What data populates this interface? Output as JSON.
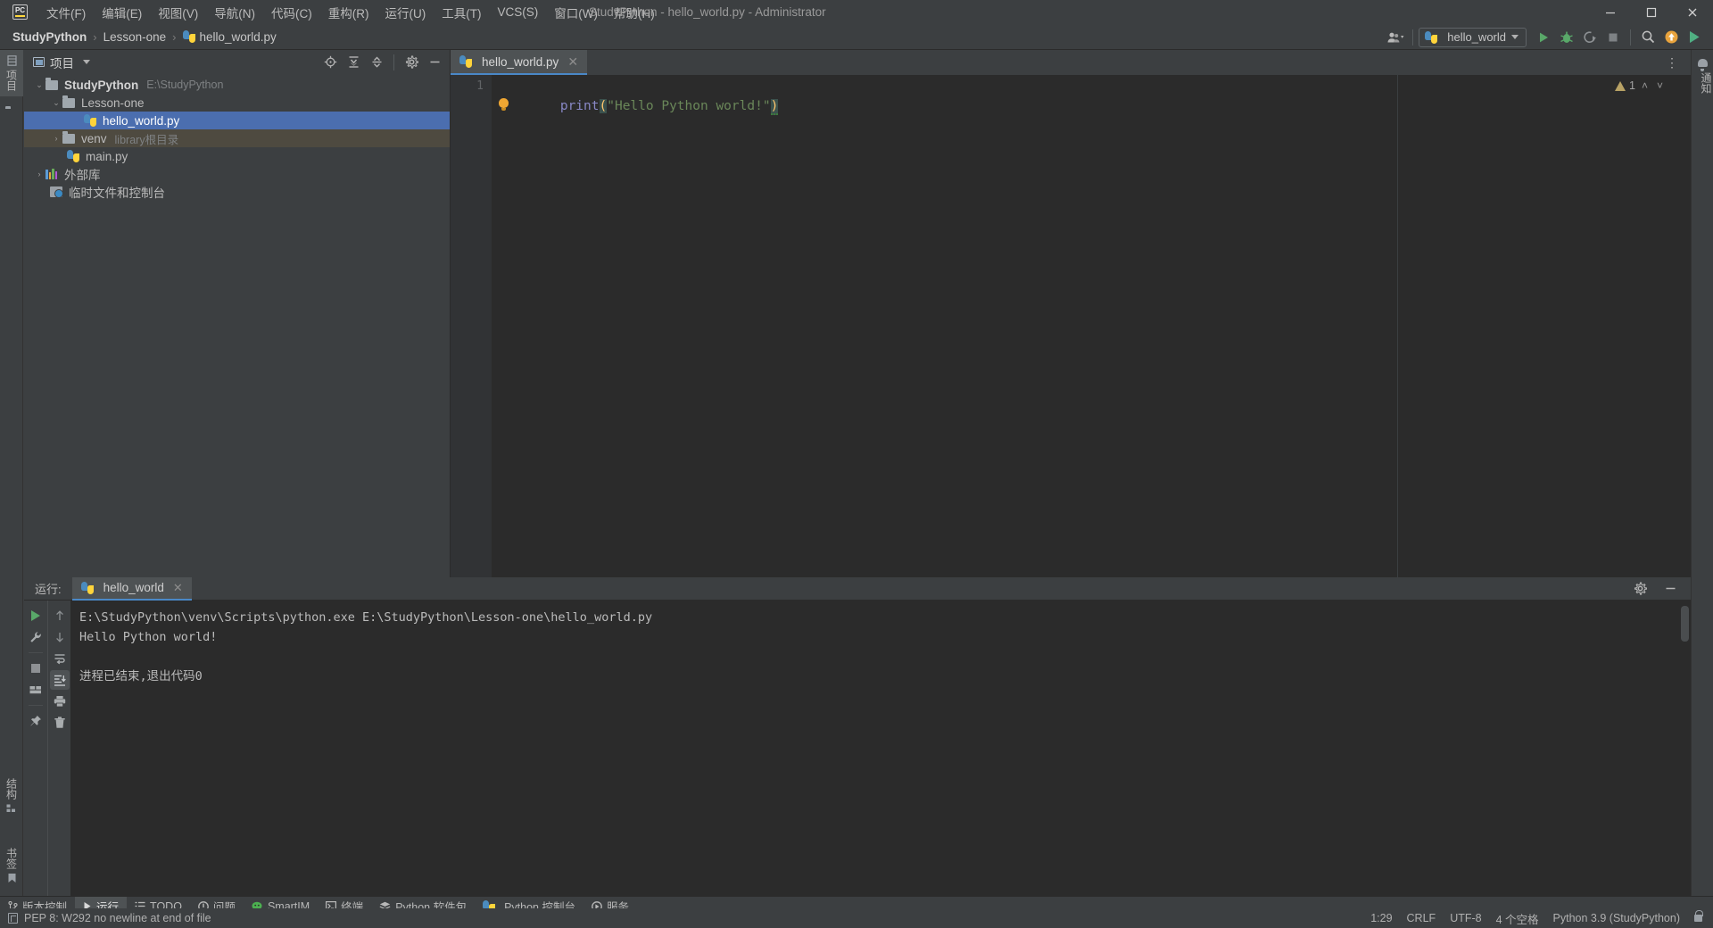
{
  "window": {
    "title": "StudyPython - hello_world.py - Administrator",
    "logo_text": "PC",
    "minimize": "—",
    "maximize": "☐",
    "close": "✕"
  },
  "menu": [
    {
      "label": "文件(F)",
      "name": "menu-file"
    },
    {
      "label": "编辑(E)",
      "name": "menu-edit"
    },
    {
      "label": "视图(V)",
      "name": "menu-view"
    },
    {
      "label": "导航(N)",
      "name": "menu-navigate"
    },
    {
      "label": "代码(C)",
      "name": "menu-code"
    },
    {
      "label": "重构(R)",
      "name": "menu-refactor"
    },
    {
      "label": "运行(U)",
      "name": "menu-run"
    },
    {
      "label": "工具(T)",
      "name": "menu-tools"
    },
    {
      "label": "VCS(S)",
      "name": "menu-vcs"
    },
    {
      "label": "窗口(W)",
      "name": "menu-window"
    },
    {
      "label": "帮助(H)",
      "name": "menu-help"
    }
  ],
  "breadcrumb": {
    "project": "StudyPython",
    "folder": "Lesson-one",
    "file": "hello_world.py",
    "separator": "›"
  },
  "toolbar": {
    "run_config": "hello_world",
    "run_tooltip": "运行",
    "debug_tooltip": "调试",
    "coverage_tooltip": "运行覆盖率",
    "stop_tooltip": "停止",
    "search_tooltip": "搜索",
    "update_tooltip": "更新",
    "profile_tooltip": "分析"
  },
  "left_strip": {
    "project_tab": "项目",
    "bottom_tabs": [
      "结构",
      "书签"
    ]
  },
  "right_strip": {
    "notifications": "通知"
  },
  "project_panel": {
    "title": "项目",
    "icons": [
      "locate-icon",
      "expand-all-icon",
      "collapse-all-icon",
      "settings-icon",
      "hide-icon"
    ],
    "tree": [
      {
        "label": "StudyPython",
        "sub": "E:\\StudyPython",
        "depth": 0,
        "kind": "folder",
        "twist": "⌄",
        "bold": true,
        "state": ""
      },
      {
        "label": "Lesson-one",
        "sub": "",
        "depth": 1,
        "kind": "folder",
        "twist": "⌄",
        "bold": false,
        "state": ""
      },
      {
        "label": "hello_world.py",
        "sub": "",
        "depth": 2,
        "kind": "python",
        "twist": "",
        "bold": false,
        "state": "selected"
      },
      {
        "label": "venv",
        "sub": "library根目录",
        "depth": 1,
        "kind": "folder",
        "twist": "›",
        "bold": false,
        "state": "hl"
      },
      {
        "label": "main.py",
        "sub": "",
        "depth": 2,
        "kind": "python",
        "twist": "",
        "bold": false,
        "state": ""
      },
      {
        "label": "外部库",
        "sub": "",
        "depth": 0,
        "kind": "library",
        "twist": "›",
        "bold": false,
        "state": ""
      },
      {
        "label": "临时文件和控制台",
        "sub": "",
        "depth": 0,
        "kind": "scratch",
        "twist": "",
        "bold": false,
        "state": ""
      }
    ]
  },
  "editor": {
    "tab_label": "hello_world.py",
    "tab_close": "✕",
    "kebab": "⋮",
    "line_numbers": [
      "1"
    ],
    "code": {
      "fn": "print",
      "open_paren": "(",
      "string": "\"Hello Python world!\"",
      "close_paren": ")"
    },
    "inspection": {
      "warning_count": "1",
      "up": "˄",
      "down": "˅"
    }
  },
  "run_panel": {
    "label": "运行:",
    "tab_label": "hello_world",
    "tab_close": "✕",
    "settings_icon": "gear-icon",
    "hide_icon": "hide-icon",
    "tools_left": [
      "rerun-icon",
      "settings-wrench-icon",
      "stop-icon",
      "layout-icon",
      "pin-icon"
    ],
    "tools_right": [
      "up-arrow-icon",
      "down-arrow-icon",
      "soft-wrap-icon",
      "scroll-to-end-icon",
      "print-icon",
      "clear-icon"
    ],
    "console": [
      "E:\\StudyPython\\venv\\Scripts\\python.exe E:\\StudyPython\\Lesson-one\\hello_world.py",
      "Hello Python world!",
      "",
      "进程已结束,退出代码0"
    ]
  },
  "bottom_tabs": [
    {
      "label": "版本控制",
      "icon": "branch-icon",
      "active": false
    },
    {
      "label": "运行",
      "icon": "play-icon",
      "active": true
    },
    {
      "label": "TODO",
      "icon": "todo-icon",
      "active": false
    },
    {
      "label": "问题",
      "icon": "problems-icon",
      "active": false
    },
    {
      "label": "SmartIM",
      "icon": "smartim-icon",
      "active": false
    },
    {
      "label": "终端",
      "icon": "terminal-icon",
      "active": false
    },
    {
      "label": "Python 软件包",
      "icon": "packages-icon",
      "active": false
    },
    {
      "label": "Python 控制台",
      "icon": "python-console-icon",
      "active": false
    },
    {
      "label": "服务",
      "icon": "services-icon",
      "active": false
    }
  ],
  "status_bar": {
    "message": "PEP 8: W292 no newline at end of file",
    "caret": "1:29",
    "line_sep": "CRLF",
    "encoding": "UTF-8",
    "indent": "4 个空格",
    "interpreter": "Python 3.9 (StudyPython)",
    "lock": "lock-icon"
  },
  "colors": {
    "chrome": "#3c3f41",
    "editor_bg": "#2b2b2b",
    "selection": "#4b6eaf",
    "accent": "#4a88c7",
    "string": "#6a8759",
    "function": "#8888c6",
    "paren": "#cc7832",
    "green": "#59a869",
    "warning": "#b8a265"
  }
}
